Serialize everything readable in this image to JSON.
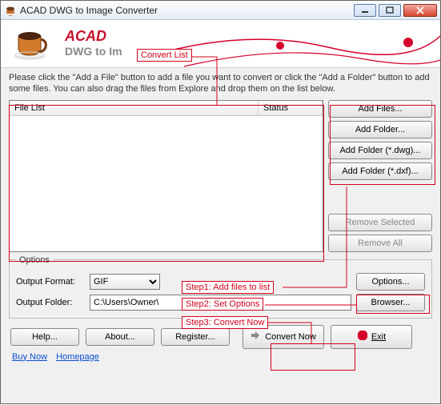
{
  "window": {
    "title": "ACAD DWG to Image Converter"
  },
  "banner": {
    "name": "ACAD",
    "sub": "DWG to Im"
  },
  "annotations": {
    "convert_list": "Convert List",
    "step1": "Step1: Add files to list",
    "step2": "Step2: Set Options",
    "step3": "Step3: Convert Now"
  },
  "instructions": "Please click the \"Add a File\" button to add a file you want to convert or click the \"Add a Folder\" button to add some files. You can also drag the files from Explore and drop them on the list below.",
  "listheaders": {
    "file": "File List",
    "status": "Status"
  },
  "sidebuttons": {
    "add_files": "Add Files...",
    "add_folder": "Add Folder...",
    "add_folder_dwg": "Add Folder (*.dwg)...",
    "add_folder_dxf": "Add Folder (*.dxf)...",
    "remove_selected": "Remove Selected",
    "remove_all": "Remove All"
  },
  "options": {
    "legend": "Options",
    "format_label": "Output Format:",
    "format_value": "GIF",
    "options_btn": "Options...",
    "folder_label": "Output Folder:",
    "folder_value": "C:\\Users\\Owner\\",
    "browse_btn": "Browser..."
  },
  "bottom": {
    "help": "Help...",
    "about": "About...",
    "register": "Register...",
    "convert": "Convert Now",
    "exit": "Exit"
  },
  "links": {
    "buy": "Buy Now",
    "home": "Homepage"
  }
}
